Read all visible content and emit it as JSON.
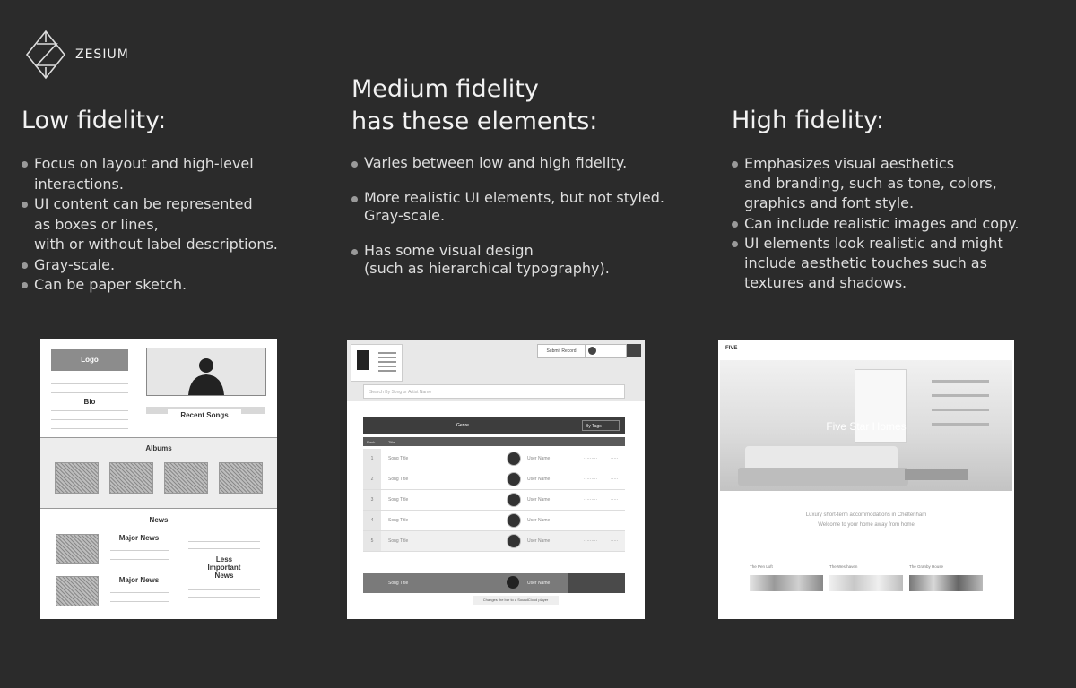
{
  "brand": {
    "name": "ZESIUM",
    "logo_icon": "zesium-diamond-logo"
  },
  "columns": [
    {
      "title": "Low fidelity:",
      "bullets": [
        "Focus on layout and high-level\ninteractions.",
        "UI content can be represented\nas boxes or lines,\nwith or without label descriptions.",
        "Gray-scale.",
        "Can be paper sketch."
      ]
    },
    {
      "title_line1": "Medium fidelity",
      "title_line2": "has these elements:",
      "bullets": [
        "Varies between low and high fidelity.",
        "More realistic UI elements, but not styled.\nGray-scale.",
        "Has some visual design\n(such as hierarchical typography)."
      ]
    },
    {
      "title": "High fidelity:",
      "bullets": [
        "Emphasizes visual aesthetics\nand branding, such as tone, colors,\ngraphics and font style.",
        "Can include realistic images and copy.",
        "UI elements look realistic and might\ninclude aesthetic touches such as\ntextures and shadows."
      ]
    }
  ],
  "low_wire": {
    "logo": "Logo",
    "bio": "Bio",
    "recent_songs": "Recent Songs",
    "albums": "Albums",
    "news": "News",
    "major_news_1": "Major News",
    "major_news_2": "Major News",
    "less_important": "Less\nImportant\nNews"
  },
  "med_wire": {
    "submit": "Submit Record",
    "search_placeholder": "Search By Song or Artist Name",
    "tab": "Genre",
    "filter": "By Tags",
    "col_num": "Rank",
    "col_title": "Title",
    "rows": [
      {
        "num": "1",
        "title": "Song Title",
        "user": "User Name"
      },
      {
        "num": "2",
        "title": "Song Title",
        "user": "User Name"
      },
      {
        "num": "3",
        "title": "Song Title",
        "user": "User Name"
      },
      {
        "num": "4",
        "title": "Song Title",
        "user": "User Name"
      },
      {
        "num": "5",
        "title": "Song Title",
        "user": "User Name"
      }
    ],
    "player_title": "Song Title",
    "player_user": "User Name",
    "tooltip": "Changes the bar to a SoundCloud player"
  },
  "high_wire": {
    "brand": "FIVE",
    "hero": "Five Star Homes",
    "tagline1": "Luxury short-term accommodations in Cheltenham",
    "tagline2": "Welcome to your home away from home",
    "thumb1": "The Pen Loft",
    "thumb2": "The Westhaven",
    "thumb3": "The Granby House"
  },
  "colors": {
    "background": "#2b2b2b",
    "text": "#e8e8e8",
    "bullet": "#9a9a9a"
  }
}
